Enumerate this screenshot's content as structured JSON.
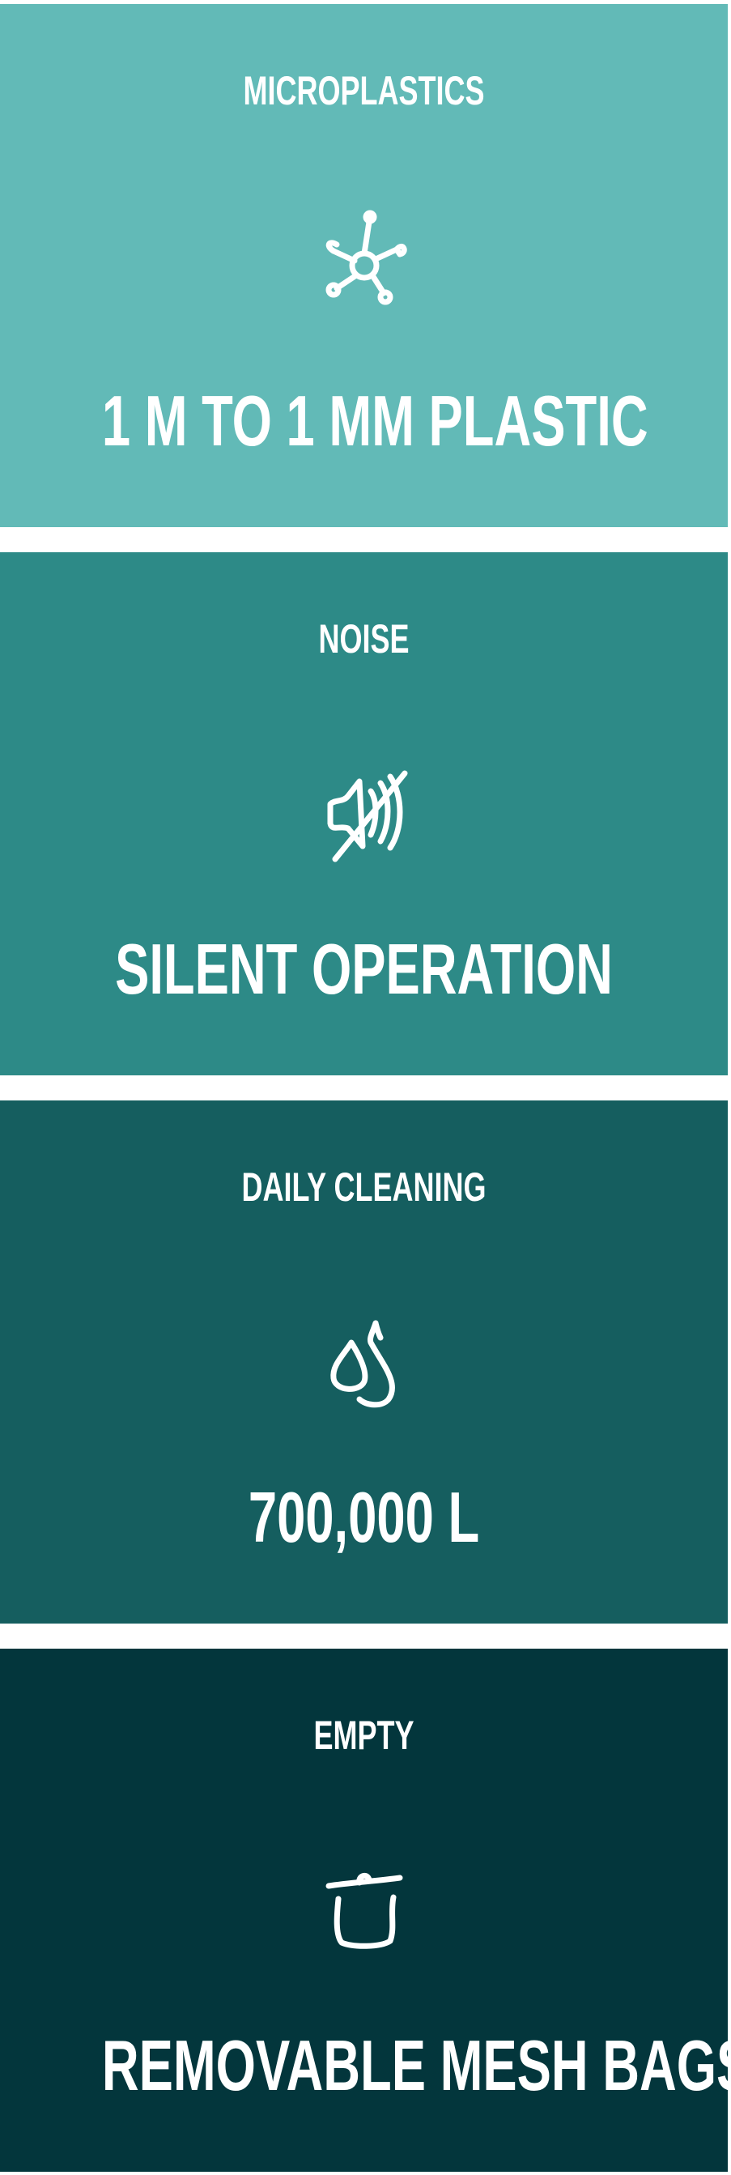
{
  "cards": [
    {
      "label": "MICROPLASTICS",
      "value": "1 M TO 1 MM PLASTIC",
      "icon": "molecule-icon",
      "background": "#62bab7"
    },
    {
      "label": "NOISE",
      "value": "SILENT OPERATION",
      "icon": "muted-sound-icon",
      "background": "#2d8a87"
    },
    {
      "label": "DAILY CLEANING",
      "value": "700,000 L",
      "icon": "water-drops-icon",
      "background": "#155e5f"
    },
    {
      "label": "EMPTY",
      "value": "REMOVABLE MESH BAGS",
      "icon": "bin-icon",
      "background": "#03363c"
    }
  ]
}
